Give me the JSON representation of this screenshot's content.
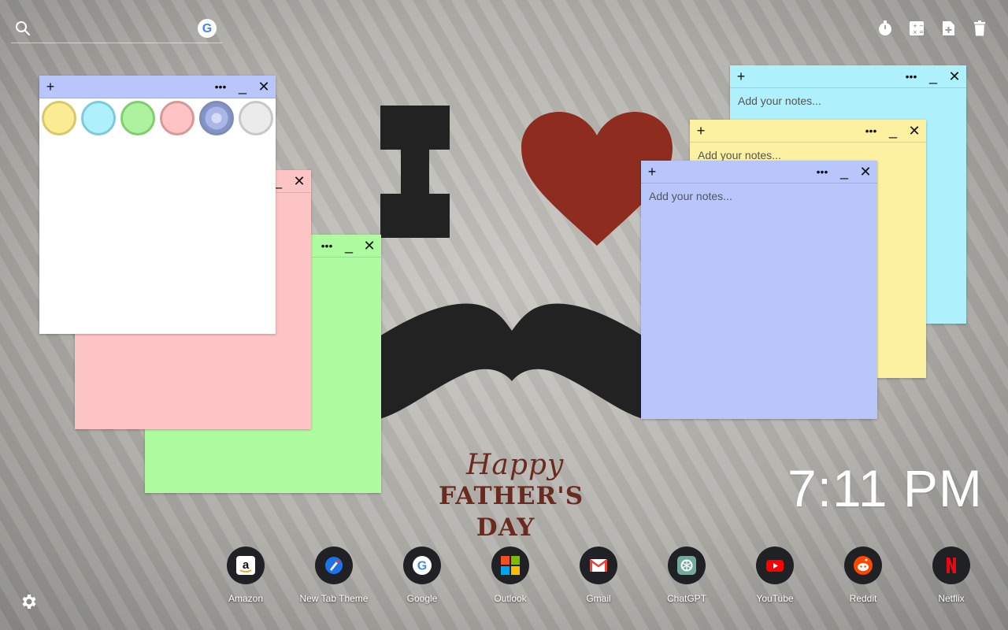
{
  "search": {
    "placeholder": ""
  },
  "toolbar": {
    "icons": [
      "timer-icon",
      "calculator-icon",
      "add-note-icon",
      "trash-icon"
    ]
  },
  "artwork": {
    "happy": "Happy",
    "fathers": "FATHER'S",
    "day": "DAY",
    "colors": {
      "letter": "#222222",
      "heart": "#8e2c1f",
      "mustache": "#222222",
      "text": "#6a2a20"
    }
  },
  "notes": {
    "placeholder": "Add your notes...",
    "colors": {
      "cyan": "#aef0fb",
      "yellow": "#fbf1a1",
      "blue": "#b8c6fc",
      "pink": "#fcc4c4",
      "green": "#aefca0",
      "white": "#ffffff"
    },
    "swatches": [
      {
        "name": "yellow",
        "fill": "#fbec94",
        "ring": "#d9c86b"
      },
      {
        "name": "cyan",
        "fill": "#aef0fb",
        "ring": "#7ccbd8"
      },
      {
        "name": "green",
        "fill": "#aef2a0",
        "ring": "#7fcf70"
      },
      {
        "name": "pink",
        "fill": "#fcc4c4",
        "ring": "#d99797"
      },
      {
        "name": "blue",
        "fill": "#a8b6e8",
        "ring": "#7f8bb8"
      },
      {
        "name": "gray",
        "fill": "#ebebeb",
        "ring": "#c8c8c8"
      }
    ]
  },
  "clock": {
    "time": "7:11 PM"
  },
  "shortcuts": [
    {
      "label": "Amazon",
      "icon": "amazon-icon"
    },
    {
      "label": "New Tab Theme",
      "icon": "new-tab-theme-icon"
    },
    {
      "label": "Google",
      "icon": "google-icon"
    },
    {
      "label": "Outlook",
      "icon": "outlook-icon"
    },
    {
      "label": "Gmail",
      "icon": "gmail-icon"
    },
    {
      "label": "ChatGPT",
      "icon": "chatgpt-icon"
    },
    {
      "label": "YouTube",
      "icon": "youtube-icon"
    },
    {
      "label": "Reddit",
      "icon": "reddit-icon"
    },
    {
      "label": "Netflix",
      "icon": "netflix-icon"
    }
  ]
}
